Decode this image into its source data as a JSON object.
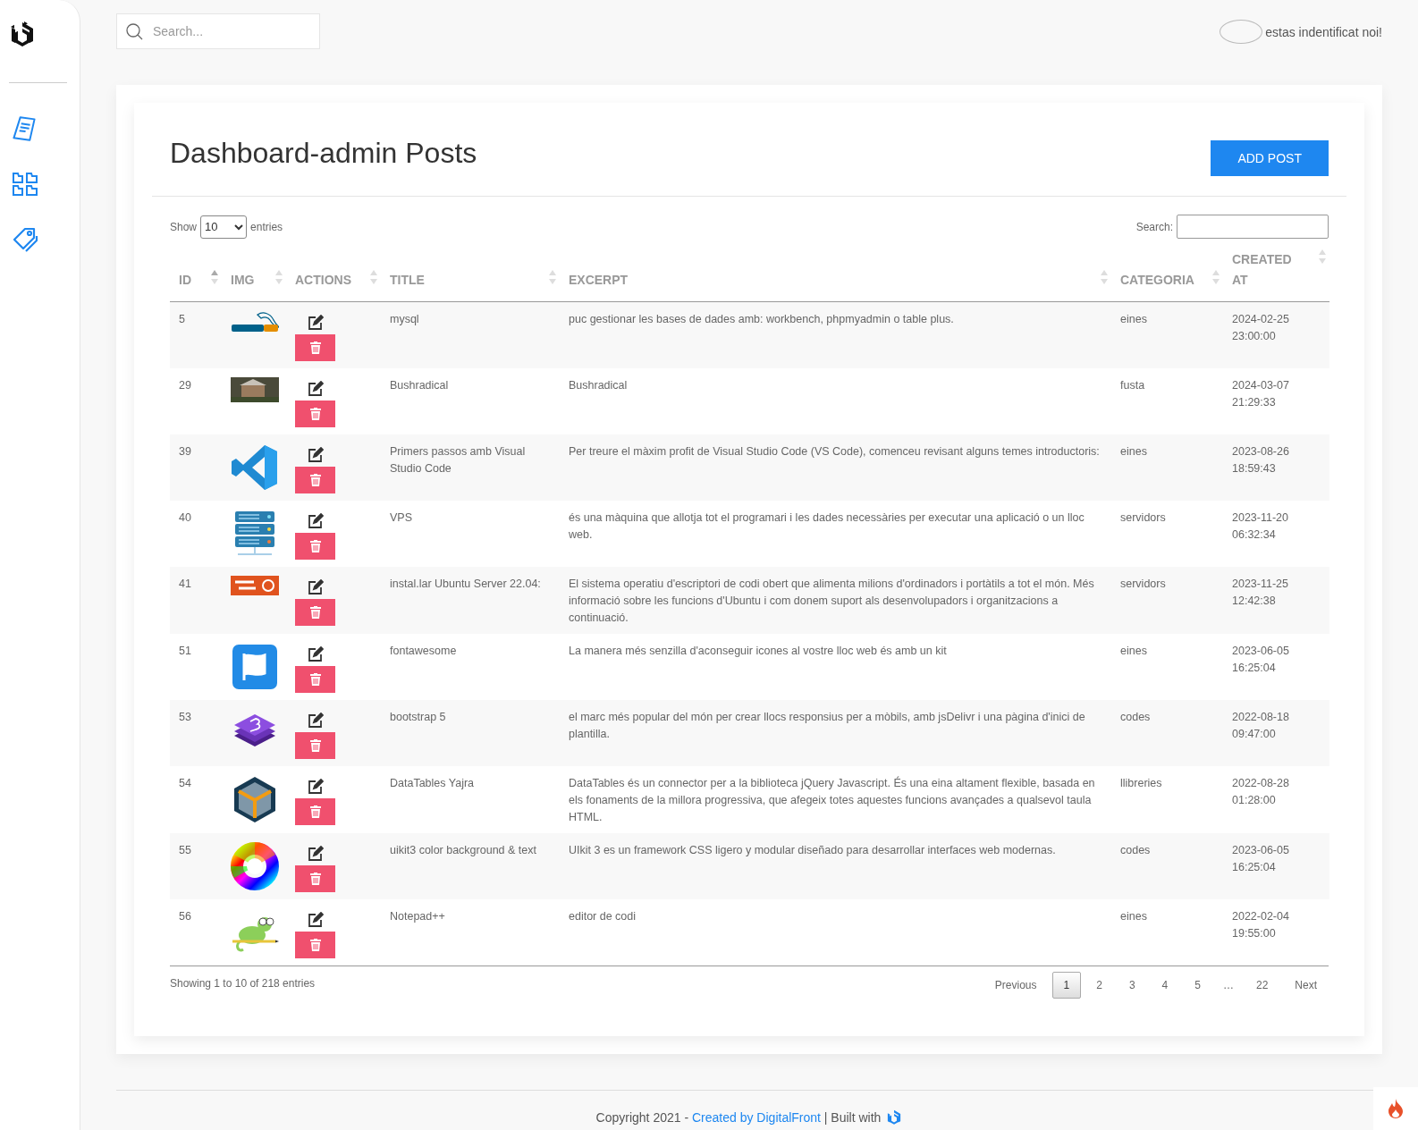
{
  "header": {
    "search": {
      "placeholder": "Search..."
    },
    "user_text": "estas indentificat noi!"
  },
  "sidebar": {
    "items": [
      {
        "kind": "posts"
      },
      {
        "kind": "grid"
      },
      {
        "kind": "tags"
      }
    ]
  },
  "page": {
    "title": "Dashboard-admin Posts",
    "add_button": "ADD POST"
  },
  "table": {
    "length_label_before": "Show",
    "length_value": "10",
    "length_label_after": "entries",
    "search_label": "Search:",
    "columns": [
      {
        "label": "ID",
        "sorted_asc": true
      },
      {
        "label": "IMG",
        "sorted_asc": false
      },
      {
        "label": "ACTIONS",
        "sorted_asc": false
      },
      {
        "label": "TITLE",
        "sorted_asc": false
      },
      {
        "label": "EXCERPT",
        "sorted_asc": false
      },
      {
        "label": "CATEGORIA",
        "sorted_asc": false
      },
      {
        "label": "CREATED AT",
        "sorted_asc": false
      }
    ],
    "rows": [
      {
        "id": "5",
        "kind": "mysql",
        "title": "mysql",
        "excerpt": "puc gestionar les bases de dades amb: workbench, phpmyadmin o table plus.",
        "categoria": "eines",
        "created_at": "2024-02-25 23:00:00"
      },
      {
        "id": "29",
        "kind": "photo",
        "title": "Bushradical",
        "excerpt": "Bushradical",
        "categoria": "fusta",
        "created_at": "2024-03-07 21:29:33"
      },
      {
        "id": "39",
        "kind": "vscode",
        "title": "Primers passos amb Visual Studio Code",
        "excerpt": "Per treure el màxim profit de Visual Studio Code (VS Code), comenceu revisant alguns temes introductoris:",
        "categoria": "eines",
        "created_at": "2023-08-26 18:59:43"
      },
      {
        "id": "40",
        "kind": "server",
        "title": "VPS",
        "excerpt": "és una màquina que allotja tot el programari i les dades necessàries per executar una aplicació o un lloc web.",
        "categoria": "servidors",
        "created_at": "2023-11-20 06:32:34"
      },
      {
        "id": "41",
        "kind": "ubuntu",
        "title": "instal.lar Ubuntu Server 22.04:",
        "excerpt": "El sistema operatiu d'escriptori de codi obert que alimenta milions d'ordinadors i portàtils a tot el món. Més informació sobre les funcions d'Ubuntu i com donem suport als desenvolupadors i organitzacions a continuació.",
        "categoria": "servidors",
        "created_at": "2023-11-25 12:42:38"
      },
      {
        "id": "51",
        "kind": "flag",
        "title": "fontawesome",
        "excerpt": "La manera més senzilla d'aconseguir icones al vostre lloc web és amb un kit",
        "categoria": "eines",
        "created_at": "2023-06-05 16:25:04"
      },
      {
        "id": "53",
        "kind": "bootstrap",
        "title": "bootstrap 5",
        "excerpt": "el marc més popular del món per crear llocs responsius per a mòbils, amb jsDelivr i una pàgina d'inici de plantilla.",
        "categoria": "codes",
        "created_at": "2022-08-18 09:47:00"
      },
      {
        "id": "54",
        "kind": "cube",
        "title": "DataTables Yajra",
        "excerpt": "DataTables és un connector per a la biblioteca jQuery Javascript. És una eina altament flexible, basada en els fonaments de la millora progressiva, que afegeix totes aquestes funcions avançades a qualsevol taula HTML.",
        "categoria": "llibreries",
        "created_at": "2022-08-28 01:28:00"
      },
      {
        "id": "55",
        "kind": "colorwheel",
        "title": "uikit3 color background & text",
        "excerpt": "UIkit 3 es un framework CSS ligero y modular diseñado para desarrollar interfaces web modernas.",
        "categoria": "codes",
        "created_at": "2023-06-05 16:25:04"
      },
      {
        "id": "56",
        "kind": "chameleon",
        "title": "Notepad++",
        "excerpt": "editor de codi",
        "categoria": "eines",
        "created_at": "2022-02-04 19:55:00"
      }
    ],
    "info": "Showing 1 to 10 of 218 entries",
    "pagination": [
      {
        "label": "Previous",
        "kind": "link"
      },
      {
        "label": "1",
        "kind": "page",
        "selected": true
      },
      {
        "label": "2",
        "kind": "page",
        "selected": false
      },
      {
        "label": "3",
        "kind": "page",
        "selected": false
      },
      {
        "label": "4",
        "kind": "page",
        "selected": false
      },
      {
        "label": "5",
        "kind": "page",
        "selected": false
      },
      {
        "label": "…",
        "kind": "ellipsis"
      },
      {
        "label": "22",
        "kind": "page",
        "selected": false
      },
      {
        "label": "Next",
        "kind": "link"
      }
    ]
  },
  "footer": {
    "text_before": "Copyright 2021 - ",
    "link": "Created by DigitalFront",
    "text_after": " | Built with"
  }
}
